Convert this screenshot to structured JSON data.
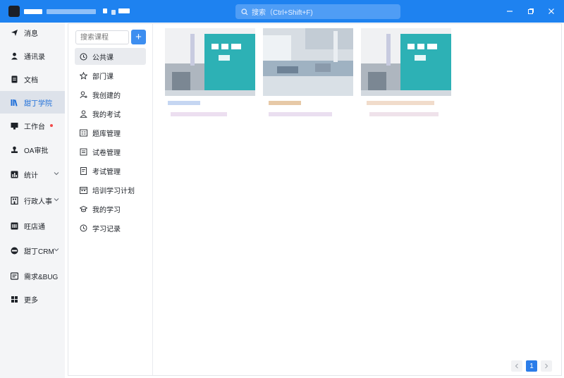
{
  "window": {
    "search_placeholder": "搜索（Ctrl+Shift+F)"
  },
  "sidebar": {
    "items": [
      {
        "label": "消息",
        "icon": "send-icon"
      },
      {
        "label": "通讯录",
        "icon": "contacts-icon"
      },
      {
        "label": "文档",
        "icon": "document-icon"
      },
      {
        "label": "甜丁学院",
        "icon": "library-icon",
        "active": true
      },
      {
        "label": "工作台",
        "icon": "monitor-icon",
        "badge": "red-dot"
      },
      {
        "label": "OA审批",
        "icon": "stamp-icon"
      },
      {
        "label": "统计",
        "icon": "stats-icon",
        "expandable": true
      },
      {
        "label": "行政人事",
        "icon": "building-icon",
        "expandable": true
      },
      {
        "label": "旺店通",
        "icon": "store-icon"
      },
      {
        "label": "甜丁CRM",
        "icon": "crm-icon",
        "expandable": true
      },
      {
        "label": "需求&BUG",
        "icon": "bug-icon"
      },
      {
        "label": "更多",
        "icon": "grid-icon"
      }
    ]
  },
  "academy": {
    "search_placeholder": "搜索课程",
    "add_label": "+",
    "menu": [
      {
        "label": "公共课",
        "icon": "clock-icon",
        "active": true
      },
      {
        "label": "部门课",
        "icon": "star-icon"
      },
      {
        "label": "我创建的",
        "icon": "user-plus-icon"
      },
      {
        "label": "我的考试",
        "icon": "user-icon"
      },
      {
        "label": "题库管理",
        "icon": "question-bank-icon"
      },
      {
        "label": "试卷管理",
        "icon": "paper-icon"
      },
      {
        "label": "考试管理",
        "icon": "exam-icon"
      },
      {
        "label": "培训学习计划",
        "icon": "calendar-icon"
      },
      {
        "label": "我的学习",
        "icon": "graduation-cap-icon"
      },
      {
        "label": "学习记录",
        "icon": "history-icon"
      }
    ]
  },
  "courses": {
    "count": 3,
    "pagination": {
      "current_page": "1"
    }
  },
  "colors": {
    "titlebar": "#1e82f0",
    "accent": "#2b7de9",
    "sidebar_bg": "#f4f5f7"
  }
}
